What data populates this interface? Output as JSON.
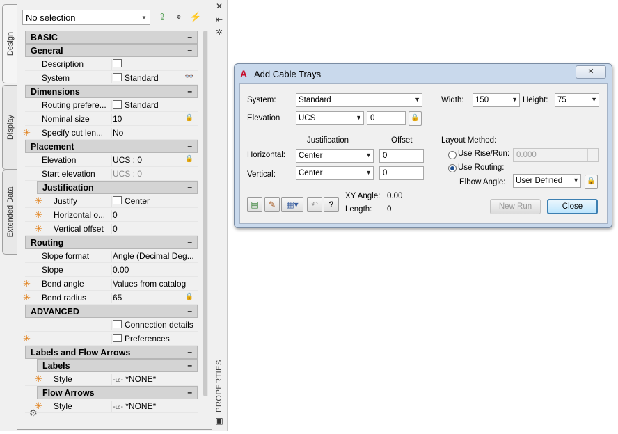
{
  "palette": {
    "tabs": [
      "Design",
      "Display",
      "Extended Data"
    ],
    "selection": "No selection",
    "side_label": "PROPERTIES",
    "sections": {
      "basic": "BASIC",
      "general": "General",
      "dimensions": "Dimensions",
      "placement": "Placement",
      "justification": "Justification",
      "routing": "Routing",
      "advanced": "ADVANCED",
      "labels_flow": "Labels and Flow Arrows",
      "labels": "Labels",
      "flow_arrows": "Flow Arrows",
      "collapse": "–"
    },
    "props": {
      "description": {
        "label": "Description",
        "value": ""
      },
      "system": {
        "label": "System",
        "value": "Standard"
      },
      "routing_pref": {
        "label": "Routing prefere...",
        "value": "Standard"
      },
      "nominal_size": {
        "label": "Nominal size",
        "value": "10"
      },
      "cut_length": {
        "label": "Specify cut len...",
        "value": "No"
      },
      "elevation": {
        "label": "Elevation",
        "value": "UCS : 0"
      },
      "start_elevation": {
        "label": "Start elevation",
        "value": "UCS : 0"
      },
      "justify": {
        "label": "Justify",
        "value": "Center"
      },
      "horizontal_offset": {
        "label": "Horizontal o...",
        "value": "0"
      },
      "vertical_offset": {
        "label": "Vertical offset",
        "value": "0"
      },
      "slope_format": {
        "label": "Slope format",
        "value": "Angle (Decimal Deg..."
      },
      "slope": {
        "label": "Slope",
        "value": "0.00"
      },
      "bend_angle": {
        "label": "Bend angle",
        "value": "Values from catalog"
      },
      "bend_radius": {
        "label": "Bend radius",
        "value": "65"
      },
      "connection_details": {
        "value": "Connection details"
      },
      "preferences": {
        "value": "Preferences"
      },
      "label_style": {
        "label": "Style",
        "value": "*NONE*"
      },
      "flow_style": {
        "label": "Style",
        "value": "*NONE*"
      }
    }
  },
  "dialog": {
    "title": "Add Cable Trays",
    "close_x": "✕",
    "system_label": "System:",
    "system_value": "Standard",
    "elevation_label": "Elevation",
    "elevation_ucs": "UCS",
    "elevation_value": "0",
    "width_label": "Width:",
    "width_value": "150",
    "height_label": "Height:",
    "height_value": "75",
    "justification_header": "Justification",
    "offset_header": "Offset",
    "horizontal_label": "Horizontal:",
    "horizontal_just": "Center",
    "horizontal_offset": "0",
    "vertical_label": "Vertical:",
    "vertical_just": "Center",
    "vertical_offset": "0",
    "layout_method_label": "Layout Method:",
    "use_rise_run": "Use Rise/Run:",
    "rise_run_value": "0.000",
    "use_routing": "Use Routing:",
    "elbow_angle_label": "Elbow Angle:",
    "elbow_angle_value": "User Defined",
    "xy_angle_label": "XY Angle:",
    "xy_angle_value": "0.00",
    "length_label": "Length:",
    "length_value": "0",
    "new_run": "New Run",
    "close": "Close",
    "help": "?"
  }
}
